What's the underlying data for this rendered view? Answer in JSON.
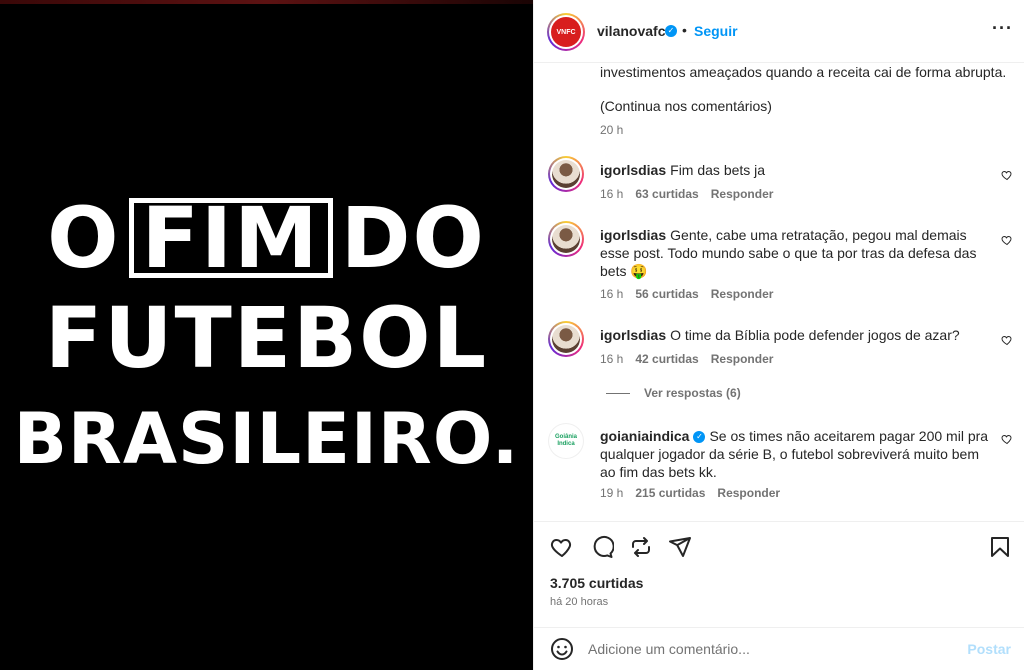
{
  "media": {
    "headline_line1_a": "O",
    "headline_line1_box": "FIM",
    "headline_line1_b": "DO",
    "headline_line2": "FUTEBOL",
    "headline_line3": "BRASILEIRO."
  },
  "header": {
    "username": "vilanovafc",
    "dot": "•",
    "follow_label": "Seguir",
    "more_icon": "more-horizontal-icon"
  },
  "caption": {
    "text_tail": "investimentos ameaçados quando a receita cai de forma abrupta.",
    "continues": "(Continua nos comentários)",
    "time": "20 h"
  },
  "comments": [
    {
      "user": "igorlsdias",
      "text": "Fim das bets ja",
      "time": "16 h",
      "likes": "63 curtidas",
      "reply": "Responder"
    },
    {
      "user": "igorlsdias",
      "text": "Gente, cabe uma retratação, pegou mal demais esse post. Todo mundo sabe o que ta por tras da defesa das bets 🤑",
      "time": "16 h",
      "likes": "56 curtidas",
      "reply": "Responder"
    },
    {
      "user": "igorlsdias",
      "text": "O time da Bíblia pode defender jogos de azar?",
      "time": "16 h",
      "likes": "42 curtidas",
      "reply": "Responder"
    },
    {
      "user": "goianiaindica",
      "text": "Se os times não aceitarem pagar 200 mil pra qualquer jogador da série B, o futebol sobreviverá muito bem ao fim das bets kk.",
      "time": "19 h",
      "likes": "215 curtidas",
      "reply": "Responder"
    }
  ],
  "view_replies": "Ver respostas (6)",
  "footer": {
    "likes": "3.705 curtidas",
    "ago": "há 20 horas"
  },
  "composer": {
    "placeholder": "Adicione um comentário...",
    "post_label": "Postar"
  },
  "colors": {
    "accent": "#0095f6",
    "post_disabled": "#b2dffc",
    "secondary_text": "#737373"
  }
}
